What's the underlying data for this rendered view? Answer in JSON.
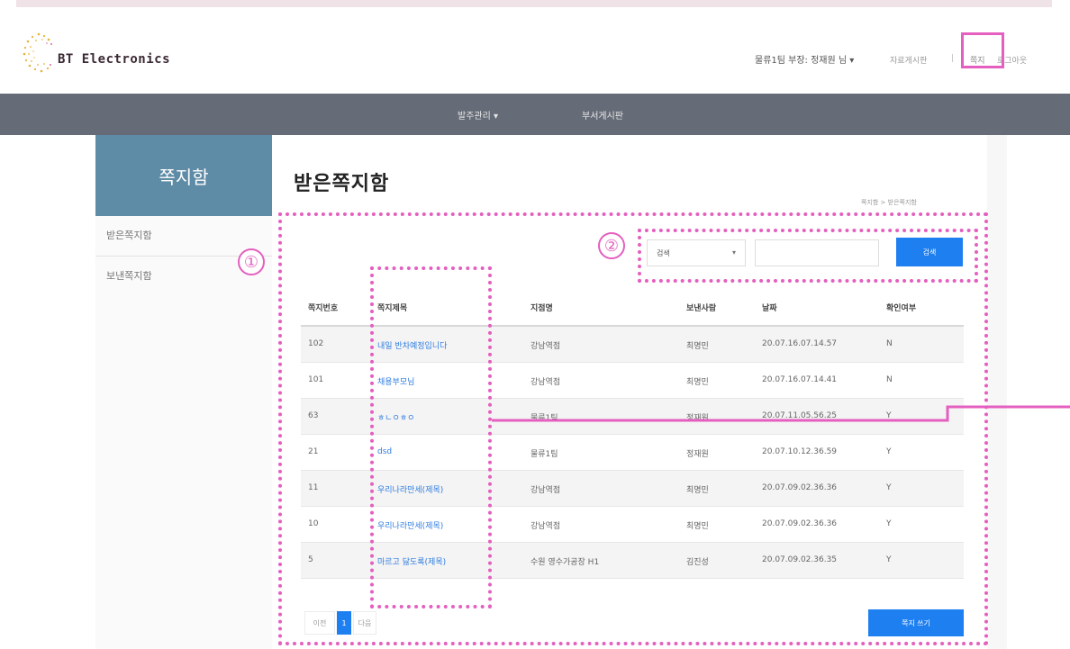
{
  "header": {
    "brand": "BT Electronics",
    "user_menu": "물류1팀 부장: 정재원 님 ▾",
    "links": {
      "board": "자료게시판",
      "sep": "|",
      "messages": "쪽지",
      "logout": "로그아웃"
    }
  },
  "nav": {
    "items": [
      "발주관리 ▾",
      "부서게시판"
    ]
  },
  "sidebar": {
    "title": "쪽지함",
    "items": [
      "받은쪽지함",
      "보낸쪽지함"
    ]
  },
  "page": {
    "title": "받은쪽지함",
    "breadcrumb": "쪽지함 > 받은쪽지함"
  },
  "annotations": {
    "one": "①",
    "two": "②"
  },
  "search": {
    "select_value": "검색",
    "button": "검색"
  },
  "table": {
    "headers": [
      "쪽지번호",
      "쪽지제목",
      "지점명",
      "보낸사람",
      "날짜",
      "확인여부"
    ],
    "rows": [
      [
        "102",
        "내일 반차예정입니다",
        "강남역점",
        "최명민",
        "20.07.16.07.14.57",
        "N"
      ],
      [
        "101",
        "채용부모님",
        "강남역점",
        "최명민",
        "20.07.16.07.14.41",
        "N"
      ],
      [
        "63",
        "ㅎㄴㅇㅎㅇ",
        "물류1팀",
        "정재원",
        "20.07.11.05.56.25",
        "Y"
      ],
      [
        "21",
        "dsd",
        "물류1팀",
        "정재원",
        "20.07.10.12.36.59",
        "Y"
      ],
      [
        "11",
        "우리나라만세(제목)",
        "강남역점",
        "최명민",
        "20.07.09.02.36.36",
        "Y"
      ],
      [
        "10",
        "우리나라만세(제목)",
        "강남역점",
        "최명민",
        "20.07.09.02.36.36",
        "Y"
      ],
      [
        "5",
        "마르고 닳도록(제목)",
        "수원 영수가공장 H1",
        "김진성",
        "20.07.09.02.36.35",
        "Y"
      ]
    ]
  },
  "pagination": {
    "prev": "이전",
    "current": "1",
    "next": "다음"
  },
  "actions": {
    "write": "쪽지 쓰기"
  },
  "colors": {
    "accent": "#1e7ff0",
    "sidebar": "#5e8ba5",
    "navbar": "#656c77",
    "annotation": "#e45fbf"
  }
}
